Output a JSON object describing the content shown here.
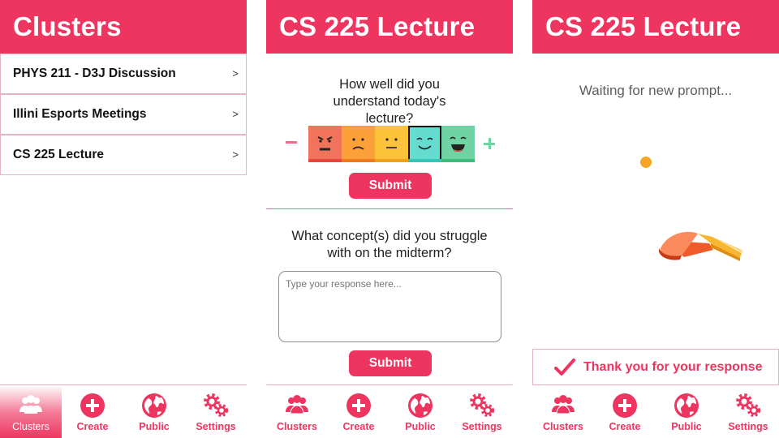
{
  "screens": [
    {
      "title": "Clusters",
      "clusters": [
        {
          "name": "PHYS 211 - D3J Discussion",
          "chevron": ">"
        },
        {
          "name": "Illini Esports Meetings",
          "chevron": ">"
        },
        {
          "name": "CS 225 Lecture",
          "chevron": ">"
        }
      ],
      "nav": [
        "Clusters",
        "Create",
        "Public",
        "Settings"
      ],
      "active_nav": "Clusters"
    },
    {
      "title": "CS 225 Lecture",
      "question1": "How well did you understand today's lecture?",
      "rating_scale": {
        "min_symbol": "minus-icon",
        "max_symbol": "plus-icon",
        "options": 5,
        "selected": 4
      },
      "submit1": "Submit",
      "question2": "What concept(s) did you struggle with on the midterm?",
      "response_placeholder": "Type your response here...",
      "submit2": "Submit",
      "nav": [
        "Clusters",
        "Create",
        "Public",
        "Settings"
      ]
    },
    {
      "title": "CS 225 Lecture",
      "waiting_text": "Waiting for new prompt...",
      "thanks_text": "Thank you for your response",
      "nav": [
        "Clusters",
        "Create",
        "Public",
        "Settings"
      ]
    }
  ],
  "colors": {
    "brand": "#ee3560",
    "face_colors": [
      "#f2735b",
      "#fca13a",
      "#fcc23a",
      "#66dbcf",
      "#6fd3a4"
    ],
    "face_bar_colors": [
      "#e8453d",
      "#f07a1d",
      "#f0a21b",
      "#33c5b5",
      "#3dbb7c"
    ]
  }
}
